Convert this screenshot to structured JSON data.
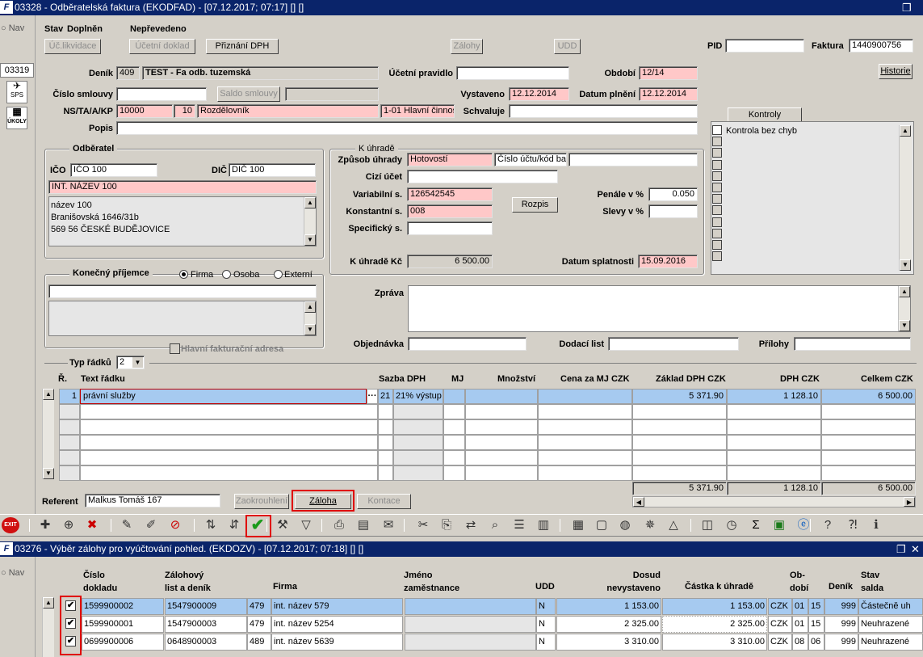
{
  "window1": {
    "title": "03328 - Odběratelská faktura (EKODFAD) - [07.12.2017; 07:17] [] []",
    "restore_icon": "restore-icon",
    "nav": "Nav",
    "left_code": "03319",
    "sps": "SPS",
    "ukoly": "ÚKOLY"
  },
  "top": {
    "stav_label": "Stav",
    "stav_value": "Doplněn",
    "neprevedeno": "Nepřevedeno",
    "btn_uc_likvidace": "Úč.likvidace",
    "btn_ucetni_doklad": "Účetní doklad",
    "btn_priznani_dph": "Přiznání DPH",
    "btn_zalohy": "Zálohy",
    "btn_udd": "UDD",
    "pid_label": "PID",
    "pid_value": "",
    "faktura_label": "Faktura",
    "faktura_value": "1440900756",
    "historie": "Historie"
  },
  "header": {
    "denik_label": "Deník",
    "denik_code": "409",
    "denik_name": "TEST - Fa odb. tuzemská",
    "ucetni_pravidlo_label": "Účetní pravidlo",
    "ucetni_pravidlo": "",
    "obdobi_label": "Období",
    "obdobi": "12/14",
    "cislo_smlouvy_label": "Číslo smlouvy",
    "cislo_smlouvy": "",
    "saldo_smlouvy": "Saldo smlouvy",
    "vystaveno_label": "Vystaveno",
    "vystaveno": "12.12.2014",
    "datum_plneni_label": "Datum plnění",
    "datum_plneni": "12.12.2014",
    "ns_label": "NS/TA/A/KP",
    "ns": "10000",
    "ta": "10",
    "ta_name": "Rozdělovník",
    "kp": "1-01 Hlavní činnos",
    "schvaluje_label": "Schvaluje",
    "schvaluje": "",
    "popis_label": "Popis",
    "popis": ""
  },
  "kontroly": {
    "button": "Kontroly",
    "items": [
      "Kontrola bez chyb"
    ]
  },
  "odberatel": {
    "title": "Odběratel",
    "ico_label": "IČO",
    "ico": "IČO 100",
    "dic_label": "DIČ",
    "dic": "DIČ 100",
    "name": "INT. NÁZEV 100",
    "address": [
      "název 100",
      "Branišovská 1646/31b",
      "569 56 ČESKÉ BUDĚJOVICE"
    ]
  },
  "k_uhrade": {
    "title": "K úhradě",
    "zpusob_label": "Způsob úhrady",
    "zpusob": "Hotovostí",
    "cislo_uctu": "Číslo účtu/kód bar",
    "cislo_uctu_value": "",
    "cizi_ucet_label": "Cizí účet",
    "cizi_ucet": "",
    "variabilni_label": "Variabilní s.",
    "variabilni": "126542545",
    "rozpis": "Rozpis",
    "penale_label": "Penále v %",
    "penale": "0.050",
    "konstantni_label": "Konstantní s.",
    "konstantni": "008",
    "slevy_label": "Slevy v %",
    "slevy": "",
    "specificky_label": "Specifický s.",
    "specificky": "",
    "kc_label": "K úhradě Kč",
    "kc": "6 500.00",
    "splatnost_label": "Datum splatnosti",
    "splatnost": "15.09.2016"
  },
  "prijemce": {
    "title": "Konečný příjemce",
    "options": [
      "Firma",
      "Osoba",
      "Externí"
    ],
    "selected": "Firma",
    "hlavni": "Hlavní fakturační adresa"
  },
  "zprava": {
    "zprava_label": "Zpráva",
    "zprava": "",
    "objednavka_label": "Objednávka",
    "objednavka": "",
    "dodaci_label": "Dodací list",
    "dodaci": "",
    "prilohy_label": "Přílohy",
    "prilohy": ""
  },
  "lines": {
    "typ_label": "Typ řádků",
    "typ_value": "2",
    "headers": [
      "Ř.",
      "Text řádku",
      "Sazba DPH",
      "MJ",
      "Množství",
      "Cena za MJ CZK",
      "Základ DPH CZK",
      "DPH CZK",
      "Celkem CZK"
    ],
    "row": {
      "n": "1",
      "text": "právní služby",
      "sazba_code": "21",
      "sazba": "21% výstup",
      "mj": "",
      "mnozstvi": "",
      "cena": "",
      "zaklad": "5 371.90",
      "dph": "1 128.10",
      "celkem": "6 500.00"
    },
    "totals": {
      "zaklad": "5 371.90",
      "dph": "1 128.10",
      "celkem": "6 500.00"
    }
  },
  "footer": {
    "referent_label": "Referent",
    "referent": "Malkus Tomáš 167",
    "zaokrouhleni": "Zaokrouhlení",
    "zaloha": "Záloha",
    "kontace": "Kontace"
  },
  "toolbar": {
    "icons": [
      "exit-icon",
      "add-record-icon",
      "add-copy-icon",
      "delete-record-icon",
      "edit-icon",
      "edit-copy-icon",
      "cancel-edit-icon",
      "sort-asc-icon",
      "sort-desc-icon",
      "confirm-icon",
      "tools-icon",
      "filter-icon",
      "print-icon",
      "print-preview-icon",
      "send-mail-icon",
      "cut-icon",
      "paste-icon",
      "replace-icon",
      "find-icon",
      "list-icon",
      "columns-icon",
      "report-icon",
      "document-icon",
      "globe-icon",
      "wheel-icon",
      "warning-icon",
      "chart-icon",
      "clock-icon",
      "sum-icon",
      "excel-icon",
      "explorer-icon",
      "help-icon",
      "context-help-icon",
      "info-icon"
    ],
    "exit_label": "EXIT"
  },
  "window2": {
    "title": "03276 - Výběr zálohy pro vyúčtování pohled. (EKDOZV) - [07.12.2017; 07:18] [] []",
    "nav": "Nav",
    "headers": {
      "cislo": "Číslo\ndokladu",
      "zalohovy": "Zálohový\nlist a deník",
      "firma": "Firma",
      "jmeno": "Jméno\nzaměstnance",
      "udd": "UDD",
      "dosud": "Dosud\nnevystaveno",
      "castka": "Částka k úhradě",
      "obdobi": "Ob-\ndobí",
      "denik": "Deník",
      "stav": "Stav\nsalda"
    },
    "rows": [
      {
        "checked": true,
        "cislo": "1599900002",
        "zalohovy": "1547900009",
        "kod": "479",
        "firma": "int. název 579",
        "jmeno": "",
        "udd": "N",
        "dosud": "1 153.00",
        "castka": "1 153.00",
        "mena": "CZK",
        "m": "01",
        "r": "15",
        "denik": "999",
        "stav": "Částečně uh"
      },
      {
        "checked": true,
        "cislo": "1599900001",
        "zalohovy": "1547900003",
        "kod": "479",
        "firma": "int. název 5254",
        "jmeno": "",
        "udd": "N",
        "dosud": "2 325.00",
        "castka": "2 325.00",
        "mena": "CZK",
        "m": "01",
        "r": "15",
        "denik": "999",
        "stav": "Neuhrazené"
      },
      {
        "checked": true,
        "cislo": "0699900006",
        "zalohovy": "0648900003",
        "kod": "489",
        "firma": "int. název 5639",
        "jmeno": "",
        "udd": "N",
        "dosud": "3 310.00",
        "castka": "3 310.00",
        "mena": "CZK",
        "m": "08",
        "r": "06",
        "denik": "999",
        "stav": "Neuhrazené"
      }
    ]
  },
  "colors": {
    "title_bar": "#0a246a",
    "pink_field": "#ffc8c8",
    "selected_row": "#a6caf0",
    "highlight_box": "#e00000"
  }
}
